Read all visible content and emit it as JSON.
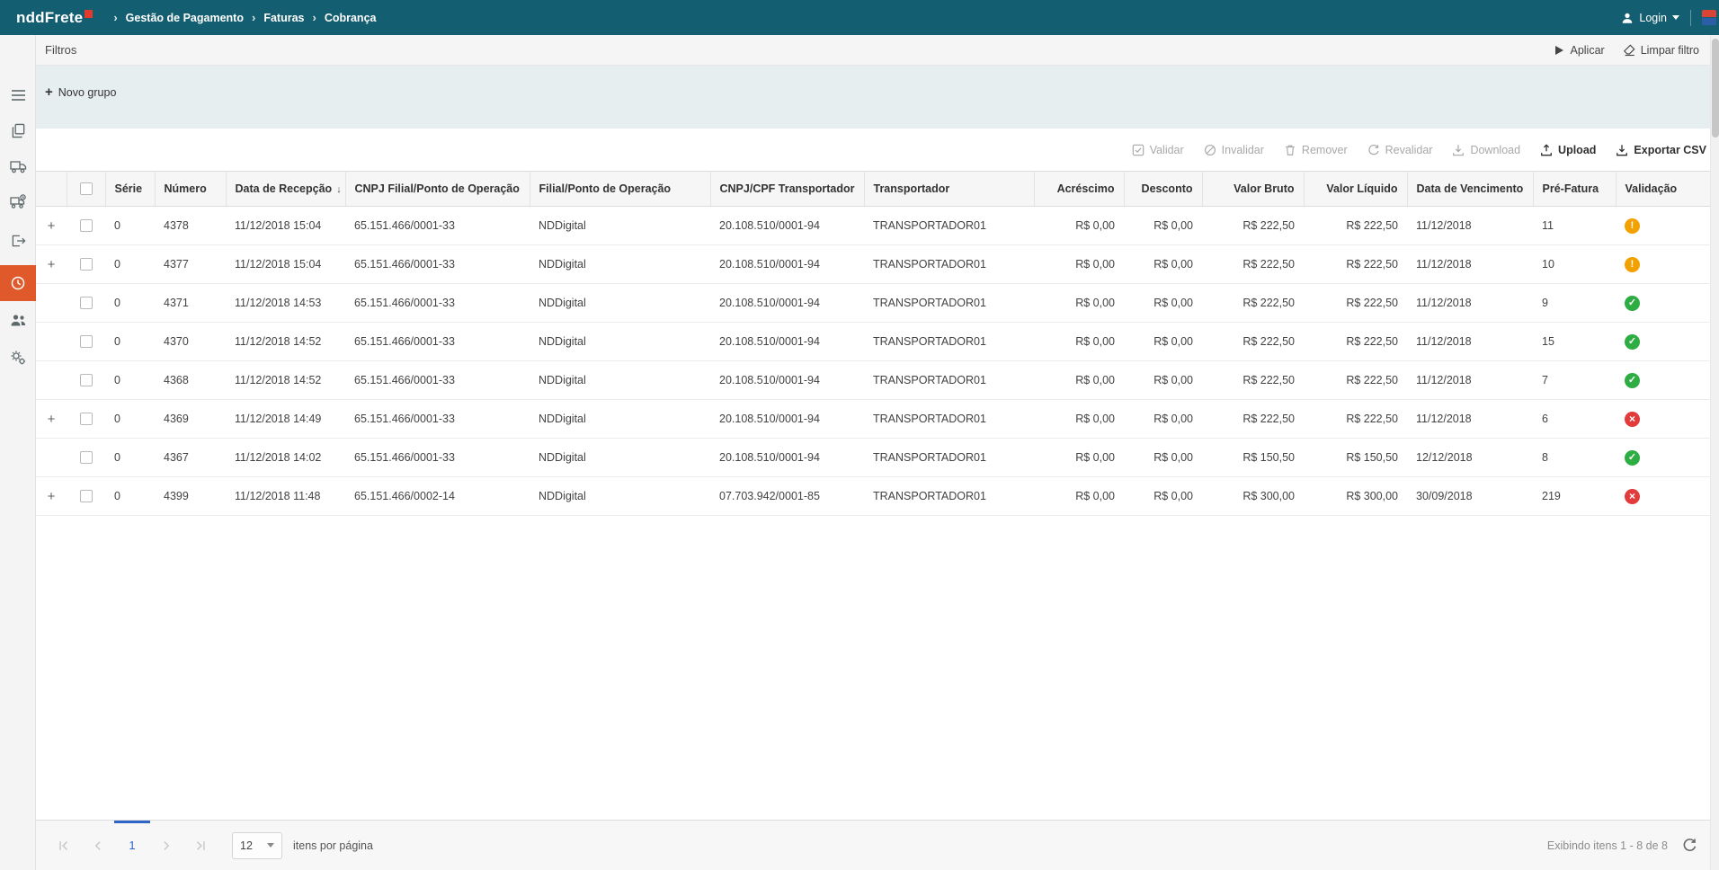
{
  "topbar": {
    "logo_text": "nddFrete",
    "breadcrumb": [
      "Gestão de Pagamento",
      "Faturas",
      "Cobrança"
    ],
    "login_label": "Login"
  },
  "filters": {
    "title": "Filtros",
    "apply_label": "Aplicar",
    "clear_label": "Limpar filtro",
    "new_group_label": "Novo grupo"
  },
  "grid_toolbar": {
    "validate_label": "Validar",
    "invalidate_label": "Invalidar",
    "remove_label": "Remover",
    "revalidate_label": "Revalidar",
    "download_label": "Download",
    "upload_label": "Upload",
    "export_csv_label": "Exportar CSV"
  },
  "table": {
    "columns": [
      {
        "label": "Série"
      },
      {
        "label": "Número"
      },
      {
        "label": "Data de Recepção",
        "sorted": "desc"
      },
      {
        "label": "CNPJ Filial/Ponto de Operação"
      },
      {
        "label": "Filial/Ponto de Operação"
      },
      {
        "label": "CNPJ/CPF Transportador"
      },
      {
        "label": "Transportador"
      },
      {
        "label": "Acréscimo"
      },
      {
        "label": "Desconto"
      },
      {
        "label": "Valor Bruto"
      },
      {
        "label": "Valor Líquido"
      },
      {
        "label": "Data de Vencimento"
      },
      {
        "label": "Pré-Fatura"
      },
      {
        "label": "Validação"
      }
    ],
    "rows": [
      {
        "expandable": true,
        "serie": "0",
        "numero": "4378",
        "data_recepcao": "11/12/2018 15:04",
        "cnpj_filial": "65.151.466/0001-33",
        "filial": "NDDigital",
        "cnpj_transportador": "20.108.510/0001-94",
        "transportador": "TRANSPORTADOR01",
        "acrescimo": "R$ 0,00",
        "desconto": "R$ 0,00",
        "valor_bruto": "R$ 222,50",
        "valor_liquido": "R$ 222,50",
        "data_vencimento": "11/12/2018",
        "pre_fatura": "11",
        "validacao": "warning"
      },
      {
        "expandable": true,
        "serie": "0",
        "numero": "4377",
        "data_recepcao": "11/12/2018 15:04",
        "cnpj_filial": "65.151.466/0001-33",
        "filial": "NDDigital",
        "cnpj_transportador": "20.108.510/0001-94",
        "transportador": "TRANSPORTADOR01",
        "acrescimo": "R$ 0,00",
        "desconto": "R$ 0,00",
        "valor_bruto": "R$ 222,50",
        "valor_liquido": "R$ 222,50",
        "data_vencimento": "11/12/2018",
        "pre_fatura": "10",
        "validacao": "warning"
      },
      {
        "expandable": false,
        "serie": "0",
        "numero": "4371",
        "data_recepcao": "11/12/2018 14:53",
        "cnpj_filial": "65.151.466/0001-33",
        "filial": "NDDigital",
        "cnpj_transportador": "20.108.510/0001-94",
        "transportador": "TRANSPORTADOR01",
        "acrescimo": "R$ 0,00",
        "desconto": "R$ 0,00",
        "valor_bruto": "R$ 222,50",
        "valor_liquido": "R$ 222,50",
        "data_vencimento": "11/12/2018",
        "pre_fatura": "9",
        "validacao": "success"
      },
      {
        "expandable": false,
        "serie": "0",
        "numero": "4370",
        "data_recepcao": "11/12/2018 14:52",
        "cnpj_filial": "65.151.466/0001-33",
        "filial": "NDDigital",
        "cnpj_transportador": "20.108.510/0001-94",
        "transportador": "TRANSPORTADOR01",
        "acrescimo": "R$ 0,00",
        "desconto": "R$ 0,00",
        "valor_bruto": "R$ 222,50",
        "valor_liquido": "R$ 222,50",
        "data_vencimento": "11/12/2018",
        "pre_fatura": "15",
        "validacao": "success"
      },
      {
        "expandable": false,
        "serie": "0",
        "numero": "4368",
        "data_recepcao": "11/12/2018 14:52",
        "cnpj_filial": "65.151.466/0001-33",
        "filial": "NDDigital",
        "cnpj_transportador": "20.108.510/0001-94",
        "transportador": "TRANSPORTADOR01",
        "acrescimo": "R$ 0,00",
        "desconto": "R$ 0,00",
        "valor_bruto": "R$ 222,50",
        "valor_liquido": "R$ 222,50",
        "data_vencimento": "11/12/2018",
        "pre_fatura": "7",
        "validacao": "success"
      },
      {
        "expandable": true,
        "serie": "0",
        "numero": "4369",
        "data_recepcao": "11/12/2018 14:49",
        "cnpj_filial": "65.151.466/0001-33",
        "filial": "NDDigital",
        "cnpj_transportador": "20.108.510/0001-94",
        "transportador": "TRANSPORTADOR01",
        "acrescimo": "R$ 0,00",
        "desconto": "R$ 0,00",
        "valor_bruto": "R$ 222,50",
        "valor_liquido": "R$ 222,50",
        "data_vencimento": "11/12/2018",
        "pre_fatura": "6",
        "validacao": "error"
      },
      {
        "expandable": false,
        "serie": "0",
        "numero": "4367",
        "data_recepcao": "11/12/2018 14:02",
        "cnpj_filial": "65.151.466/0001-33",
        "filial": "NDDigital",
        "cnpj_transportador": "20.108.510/0001-94",
        "transportador": "TRANSPORTADOR01",
        "acrescimo": "R$ 0,00",
        "desconto": "R$ 0,00",
        "valor_bruto": "R$ 150,50",
        "valor_liquido": "R$ 150,50",
        "data_vencimento": "12/12/2018",
        "pre_fatura": "8",
        "validacao": "success"
      },
      {
        "expandable": true,
        "serie": "0",
        "numero": "4399",
        "data_recepcao": "11/12/2018 11:48",
        "cnpj_filial": "65.151.466/0002-14",
        "filial": "NDDigital",
        "cnpj_transportador": "07.703.942/0001-85",
        "transportador": "TRANSPORTADOR01",
        "acrescimo": "R$ 0,00",
        "desconto": "R$ 0,00",
        "valor_bruto": "R$ 300,00",
        "valor_liquido": "R$ 300,00",
        "data_vencimento": "30/09/2018",
        "pre_fatura": "219",
        "validacao": "error"
      }
    ]
  },
  "pagination": {
    "current_page": "1",
    "page_size": "12",
    "per_page_label": "itens por página",
    "status_text": "Exibindo itens 1 - 8 de 8"
  },
  "colors": {
    "topbar_bg": "#135e70",
    "sidebar_active_bg": "#e0592b",
    "logo_mark": "#e23b2e",
    "status_success": "#2ead43",
    "status_warning": "#f2a100",
    "status_error": "#e13b3b",
    "pager_active": "#2f64c8"
  }
}
